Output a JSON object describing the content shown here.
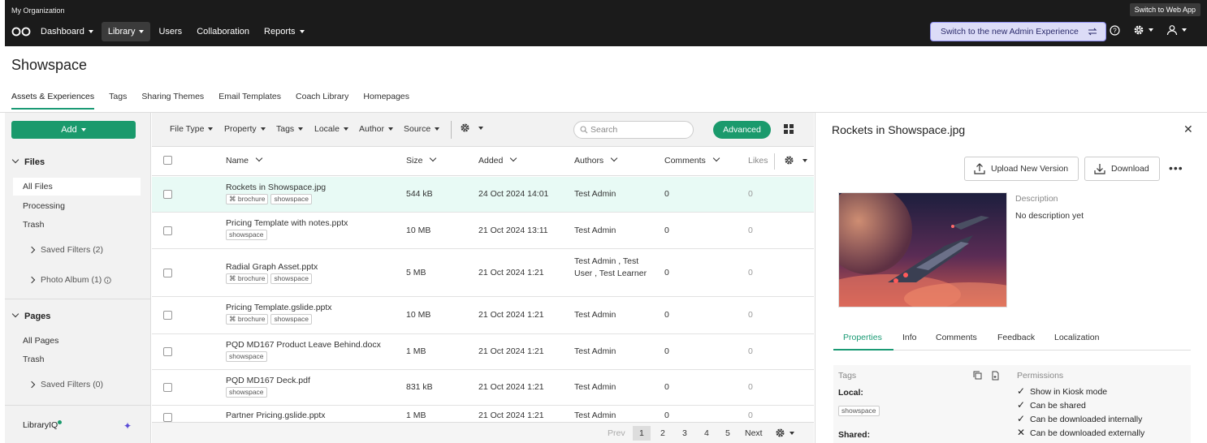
{
  "topbar": {
    "org": "My Organization",
    "switch_web_app": "Switch to Web App",
    "nav": [
      {
        "label": "Dashboard",
        "caret": true,
        "active": false
      },
      {
        "label": "Library",
        "caret": true,
        "active": true
      },
      {
        "label": "Users",
        "caret": false,
        "active": false
      },
      {
        "label": "Collaboration",
        "caret": false,
        "active": false
      },
      {
        "label": "Reports",
        "caret": true,
        "active": false
      }
    ],
    "new_admin": "Switch to the new Admin Experience"
  },
  "page": {
    "title": "Showspace",
    "tabs": [
      "Assets & Experiences",
      "Tags",
      "Sharing Themes",
      "Email Templates",
      "Coach Library",
      "Homepages"
    ]
  },
  "sidebar": {
    "add_label": "Add",
    "files_header": "Files",
    "all_files": "All Files",
    "processing": "Processing",
    "trash": "Trash",
    "saved_filters": "Saved Filters (2)",
    "photo_album": "Photo Album (1)",
    "pages_header": "Pages",
    "all_pages": "All Pages",
    "pages_trash": "Trash",
    "pages_saved_filters": "Saved Filters (0)",
    "libraryiq": "LibraryIQ"
  },
  "filters": [
    "File Type",
    "Property",
    "Tags",
    "Locale",
    "Author",
    "Source"
  ],
  "search": {
    "placeholder": "Search"
  },
  "advanced_label": "Advanced",
  "table": {
    "headers": {
      "name": "Name",
      "size": "Size",
      "added": "Added",
      "authors": "Authors",
      "comments": "Comments",
      "likes": "Likes"
    },
    "rows": [
      {
        "name": "Rockets in Showspace.jpg",
        "tags": [
          {
            "t": "brochure",
            "icon": true
          },
          {
            "t": "showspace",
            "icon": false
          }
        ],
        "size": "544 kB",
        "added": "24 Oct 2024 14:01",
        "authors": "Test Admin",
        "comments": "0",
        "likes": "0"
      },
      {
        "name": "Pricing Template with notes.pptx",
        "tags": [
          {
            "t": "showspace",
            "icon": false
          }
        ],
        "size": "10 MB",
        "added": "21 Oct 2024 13:11",
        "authors": "Test Admin",
        "comments": "0",
        "likes": "0"
      },
      {
        "name": "Radial Graph Asset.pptx",
        "tags": [
          {
            "t": "brochure",
            "icon": true
          },
          {
            "t": "showspace",
            "icon": false
          }
        ],
        "size": "5 MB",
        "added": "21 Oct 2024 1:21",
        "authors": "Test Admin , Test User , Test Learner",
        "comments": "0",
        "likes": "0"
      },
      {
        "name": "Pricing Template.gslide.pptx",
        "tags": [
          {
            "t": "brochure",
            "icon": true
          },
          {
            "t": "showspace",
            "icon": false
          }
        ],
        "size": "10 MB",
        "added": "21 Oct 2024 1:21",
        "authors": "Test Admin",
        "comments": "0",
        "likes": "0"
      },
      {
        "name": "PQD MD167 Product Leave Behind.docx",
        "tags": [
          {
            "t": "showspace",
            "icon": false
          }
        ],
        "size": "1 MB",
        "added": "21 Oct 2024 1:21",
        "authors": "Test Admin",
        "comments": "0",
        "likes": "0"
      },
      {
        "name": "PQD MD167 Deck.pdf",
        "tags": [
          {
            "t": "showspace",
            "icon": false
          }
        ],
        "size": "831 kB",
        "added": "21 Oct 2024 1:21",
        "authors": "Test Admin",
        "comments": "0",
        "likes": "0"
      },
      {
        "name": "Partner Pricing.gslide.pptx",
        "tags": [],
        "size": "1 MB",
        "added": "21 Oct 2024 1:21",
        "authors": "Test Admin",
        "comments": "0",
        "likes": "0"
      }
    ]
  },
  "pagination": {
    "prev": "Prev",
    "pages": [
      "1",
      "2",
      "3",
      "4",
      "5"
    ],
    "next": "Next"
  },
  "detail": {
    "title": "Rockets in Showspace.jpg",
    "upload_label": "Upload New Version",
    "download_label": "Download",
    "description_label": "Description",
    "description_value": "No description yet",
    "tabs": [
      "Properties",
      "Info",
      "Comments",
      "Feedback",
      "Localization"
    ],
    "tags_label": "Tags",
    "local_label": "Local:",
    "local_tag": "showspace",
    "shared_label": "Shared:",
    "permissions_label": "Permissions",
    "permissions": [
      {
        "label": "Show in Kiosk mode",
        "enabled": true
      },
      {
        "label": "Can be shared",
        "enabled": true
      },
      {
        "label": "Can be downloaded internally",
        "enabled": true
      },
      {
        "label": "Can be downloaded externally",
        "enabled": false
      }
    ]
  },
  "colors": {
    "accent": "#1a9a6c",
    "topbar": "#1b1b1b",
    "selected_row": "#e8faf5"
  }
}
